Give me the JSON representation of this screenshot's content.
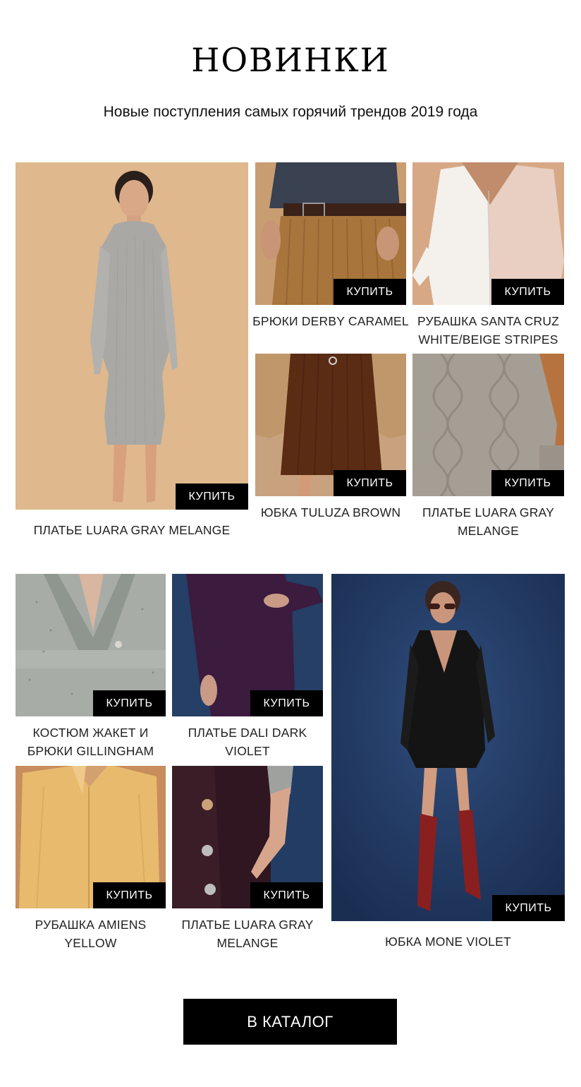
{
  "header": {
    "title": "НОВИНКИ",
    "subtitle": "Новые поступления самых горячий трендов 2019 года"
  },
  "buy_label": "КУПИТЬ",
  "products": {
    "p1": {
      "caption": "ПЛАТЬЕ LUARA GRAY MELANGE"
    },
    "p2": {
      "caption": "БРЮКИ DERBY CARAMEL"
    },
    "p3": {
      "caption": "РУБАШКА SANTA CRUZ WHITE/BEIGE STRIPES"
    },
    "p4": {
      "caption": "ЮБКА TULUZA BROWN"
    },
    "p5": {
      "caption": "ПЛАТЬЕ LUARA GRAY MELANGE"
    },
    "p6": {
      "caption": "КОСТЮМ ЖАКЕТ И БРЮКИ GILLINGHAM"
    },
    "p7": {
      "caption": "ПЛАТЬЕ DALI DARK VIOLET"
    },
    "p8": {
      "caption": "РУБАШКА AMIENS YELLOW"
    },
    "p9": {
      "caption": "ПЛАТЬЕ LUARA GRAY MELANGE"
    },
    "p10": {
      "caption": "ЮБКА MONE VIOLET"
    }
  },
  "catalog_button": "В КАТАЛОГ",
  "colors": {
    "beige_bg": "#dfb489",
    "navy_bg": "#22385c",
    "buy_bg": "#000000"
  }
}
